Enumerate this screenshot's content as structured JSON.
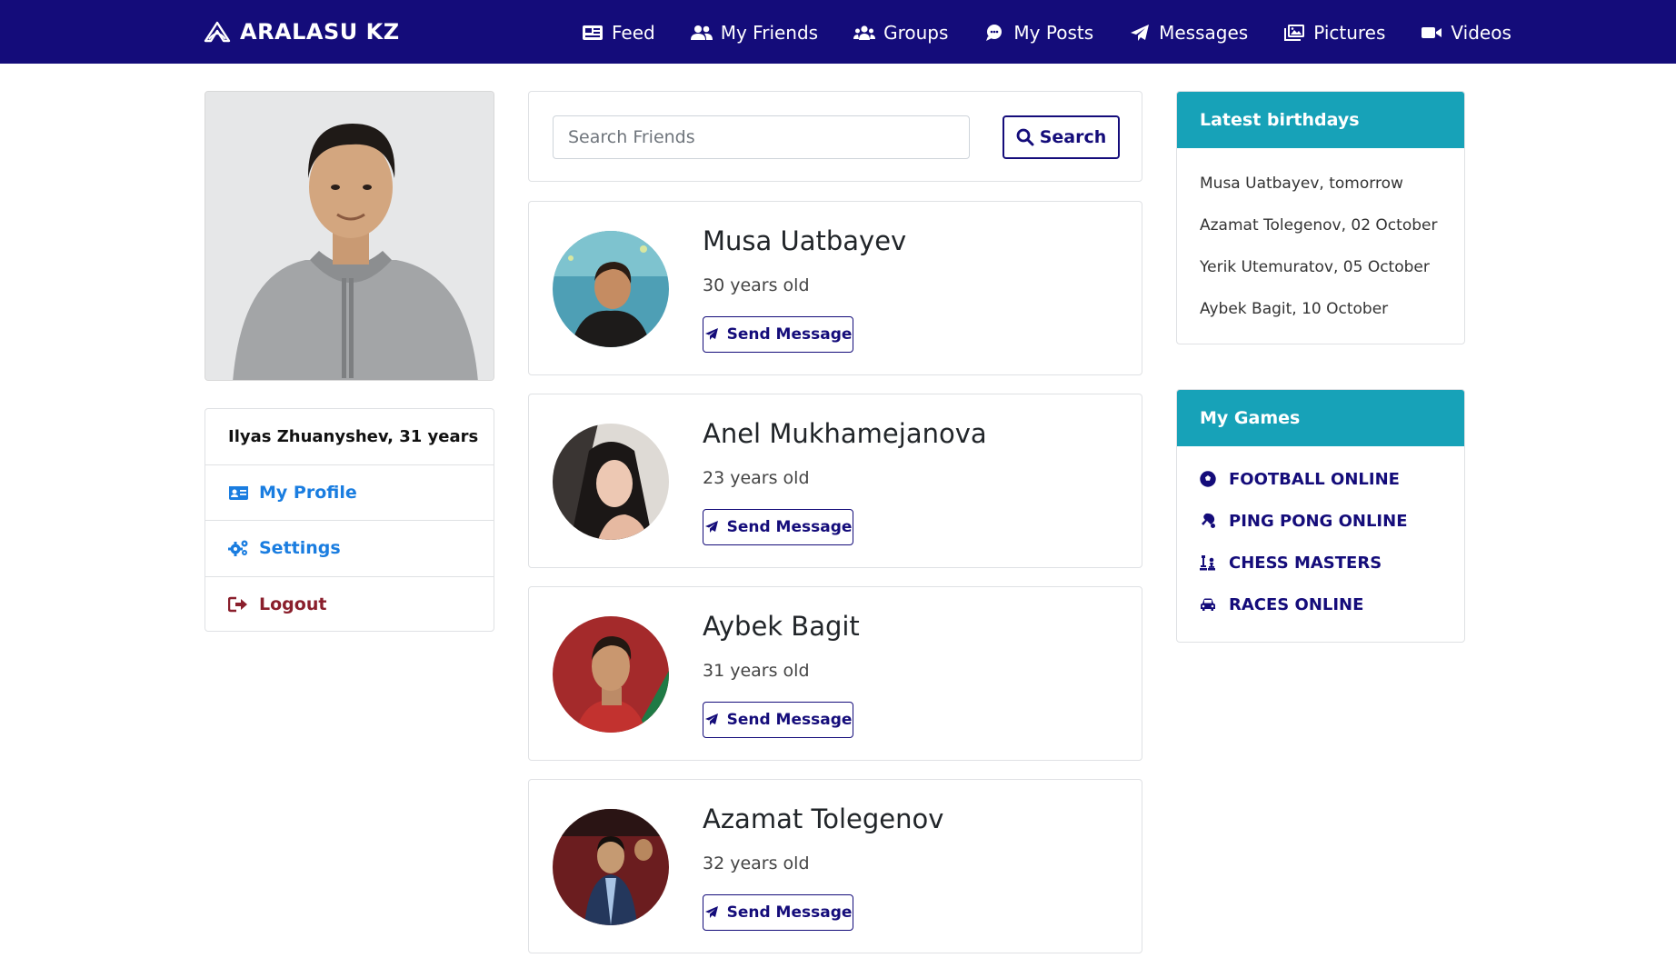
{
  "brand": {
    "name": "ARALASU KZ"
  },
  "nav": {
    "items": [
      {
        "label": "Feed",
        "icon": "newspaper-icon"
      },
      {
        "label": "My Friends",
        "icon": "user-friends-icon"
      },
      {
        "label": "Groups",
        "icon": "users-icon"
      },
      {
        "label": "My Posts",
        "icon": "comment-icon"
      },
      {
        "label": "Messages",
        "icon": "paper-plane-icon"
      },
      {
        "label": "Pictures",
        "icon": "images-icon"
      },
      {
        "label": "Videos",
        "icon": "video-icon"
      }
    ]
  },
  "profile": {
    "name_line": "Ilyas Zhuanyshev, 31 years",
    "menu": [
      {
        "label": "My Profile",
        "icon": "id-card-icon"
      },
      {
        "label": "Settings",
        "icon": "cogs-icon"
      },
      {
        "label": "Logout",
        "icon": "sign-out-icon"
      }
    ]
  },
  "search": {
    "placeholder": "Search Friends",
    "value": "",
    "button_label": "Search"
  },
  "friends": [
    {
      "name": "Musa Uatbayev",
      "age": "30 years old",
      "button_label": "Send Message"
    },
    {
      "name": "Anel Mukhamejanova",
      "age": "23 years old",
      "button_label": "Send Message"
    },
    {
      "name": "Aybek Bagit",
      "age": "31 years old",
      "button_label": "Send Message"
    },
    {
      "name": "Azamat Tolegenov",
      "age": "32 years old",
      "button_label": "Send Message"
    }
  ],
  "birthdays": {
    "title": "Latest birthdays",
    "items": [
      "Musa Uatbayev, tomorrow",
      "Azamat Tolegenov, 02 October",
      "Yerik Utemuratov, 05 October",
      "Aybek Bagit, 10 October"
    ]
  },
  "games": {
    "title": "My Games",
    "items": [
      {
        "label": "FOOTBALL ONLINE",
        "icon": "futbol-icon"
      },
      {
        "label": "PING PONG ONLINE",
        "icon": "table-tennis-icon"
      },
      {
        "label": "CHESS MASTERS",
        "icon": "chess-icon"
      },
      {
        "label": "RACES ONLINE",
        "icon": "car-icon"
      }
    ]
  },
  "colors": {
    "navbar": "#140c7a",
    "accent_teal": "#17a2b8",
    "link_blue": "#1a7de0",
    "logout_red": "#8a1f2c"
  }
}
